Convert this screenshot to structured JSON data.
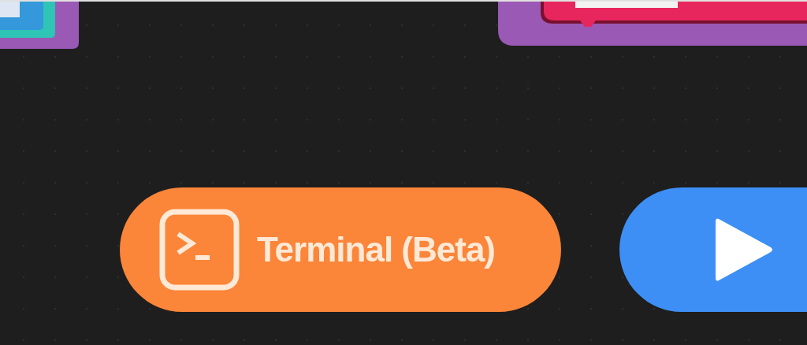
{
  "buttons": [
    {
      "kind": "terminal",
      "label": "Terminal (Beta)"
    },
    {
      "kind": "run"
    }
  ]
}
